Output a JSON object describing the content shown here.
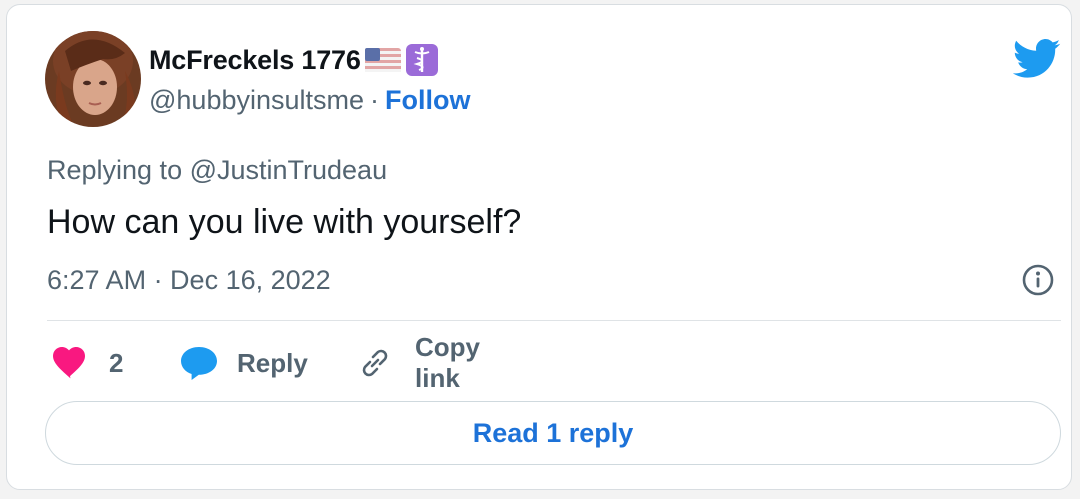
{
  "tweet": {
    "author": {
      "display_name": "McFreckels 1776",
      "handle": "@hubbyinsultsme",
      "separator": "·",
      "follow_label": "Follow",
      "badges": [
        "us-flag-icon",
        "caduceus-icon"
      ]
    },
    "replying_to": "Replying to @JustinTrudeau",
    "text": "How can you live with yourself?",
    "timestamp": "6:27 AM · Dec 16, 2022",
    "actions": {
      "like_count": "2",
      "reply_label": "Reply",
      "copy_link_label": "Copy link"
    },
    "read_replies_label": "Read 1 reply"
  },
  "colors": {
    "link_blue": "#1d72d8",
    "twitter_blue": "#1d9bf0",
    "heart_pink": "#f91880",
    "muted_text": "#536471"
  }
}
